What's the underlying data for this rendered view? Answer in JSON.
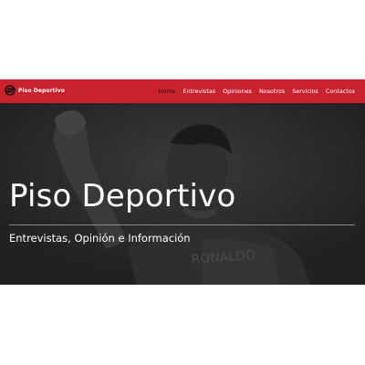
{
  "navbar": {
    "brand_name": "Piso Deportivo",
    "brand_color": "#c8222f",
    "logo_icon": "piso-deportivo-logo",
    "links": [
      {
        "label": "Home",
        "active": true
      },
      {
        "label": "Entrevistas",
        "active": false
      },
      {
        "label": "Opiniones",
        "active": false
      },
      {
        "label": "Nosotros",
        "active": false
      },
      {
        "label": "Servicios",
        "active": false
      },
      {
        "label": "Contactos",
        "active": false
      }
    ]
  },
  "hero": {
    "title": "Piso Deportivo",
    "subtitle": "Entrevistas, Opinión e Información",
    "background_image": "footballer-raising-fist-grayscale"
  }
}
